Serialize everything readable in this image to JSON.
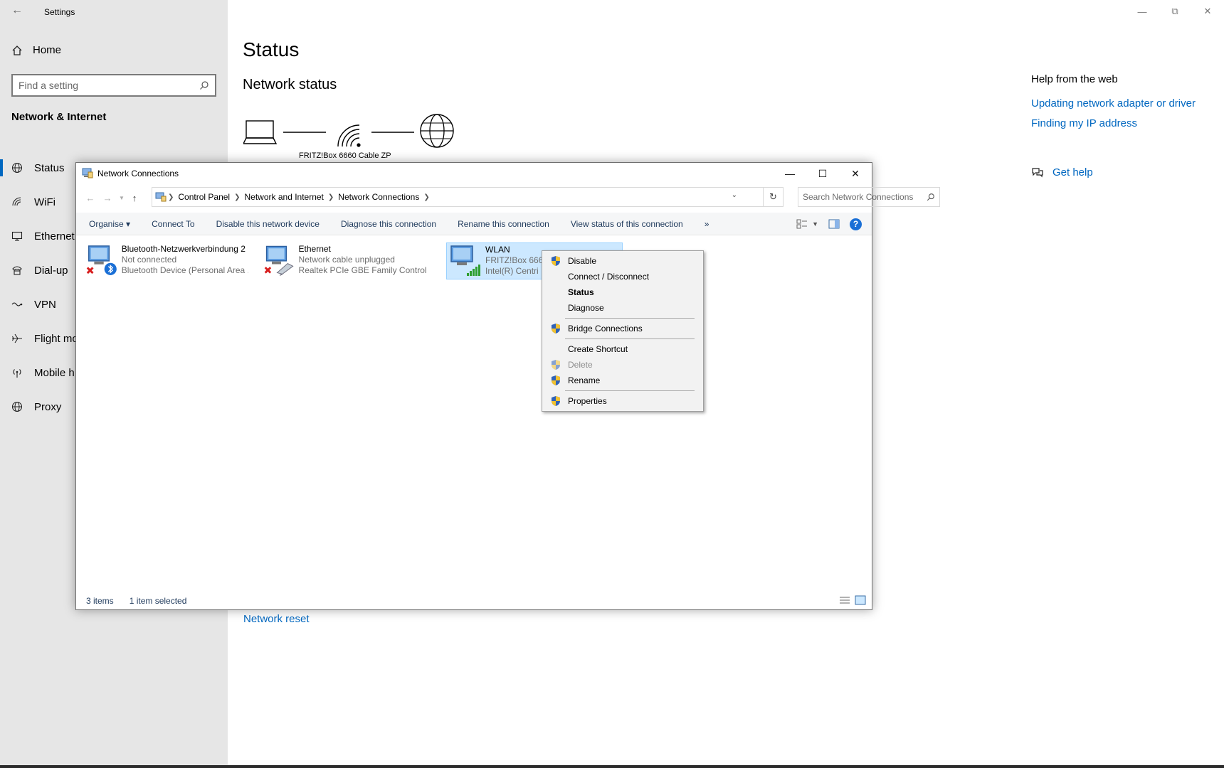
{
  "settings": {
    "title": "Settings",
    "home": "Home",
    "search_placeholder": "Find a setting",
    "section": "Network & Internet",
    "nav": [
      {
        "label": "Status",
        "icon": "globe-icon"
      },
      {
        "label": "WiFi",
        "icon": "wifi-icon"
      },
      {
        "label": "Ethernet",
        "icon": "ethernet-icon"
      },
      {
        "label": "Dial-up",
        "icon": "dialup-icon"
      },
      {
        "label": "VPN",
        "icon": "vpn-icon"
      },
      {
        "label": "Flight mo",
        "icon": "airplane-icon"
      },
      {
        "label": "Mobile h",
        "icon": "hotspot-icon"
      },
      {
        "label": "Proxy",
        "icon": "globe-icon"
      }
    ],
    "page_title": "Status",
    "network_status": "Network status",
    "router_label": "FRITZ!Box 6660 Cable ZP",
    "network_reset": "Network reset",
    "help": {
      "title": "Help from the web",
      "links": [
        "Updating network adapter or driver",
        "Finding my IP address"
      ],
      "get_help": "Get help"
    }
  },
  "nc": {
    "title": "Network Connections",
    "breadcrumb": [
      "Control Panel",
      "Network and Internet",
      "Network Connections"
    ],
    "search_placeholder": "Search Network Connections",
    "commands": [
      "Organise ▾",
      "Connect To",
      "Disable this network device",
      "Diagnose this connection",
      "Rename this connection",
      "View status of this connection",
      "»"
    ],
    "connections": [
      {
        "name": "Bluetooth-Netzwerkverbindung 2",
        "status": "Not connected",
        "device": "Bluetooth Device (Personal Area ..."
      },
      {
        "name": "Ethernet",
        "status": "Network cable unplugged",
        "device": "Realtek PCIe GBE Family Controller"
      },
      {
        "name": "WLAN",
        "status": "FRITZ!Box 6660",
        "device": "Intel(R) Centri"
      }
    ],
    "status_bar": {
      "count": "3 items",
      "selected": "1 item selected"
    }
  },
  "context_menu": {
    "items": [
      {
        "label": "Disable",
        "shield": true
      },
      {
        "label": "Connect / Disconnect",
        "shield": false
      },
      {
        "label": "Status",
        "shield": false,
        "bold": true
      },
      {
        "label": "Diagnose",
        "shield": false
      },
      {
        "label": "Bridge Connections",
        "shield": true
      },
      {
        "label": "Create Shortcut",
        "shield": false
      },
      {
        "label": "Delete",
        "shield": true,
        "disabled": true
      },
      {
        "label": "Rename",
        "shield": true
      },
      {
        "label": "Properties",
        "shield": true
      }
    ]
  },
  "colors": {
    "accent": "#0067c0",
    "sidebar_bg": "#e6e6e6",
    "selection": "#cce8ff"
  }
}
